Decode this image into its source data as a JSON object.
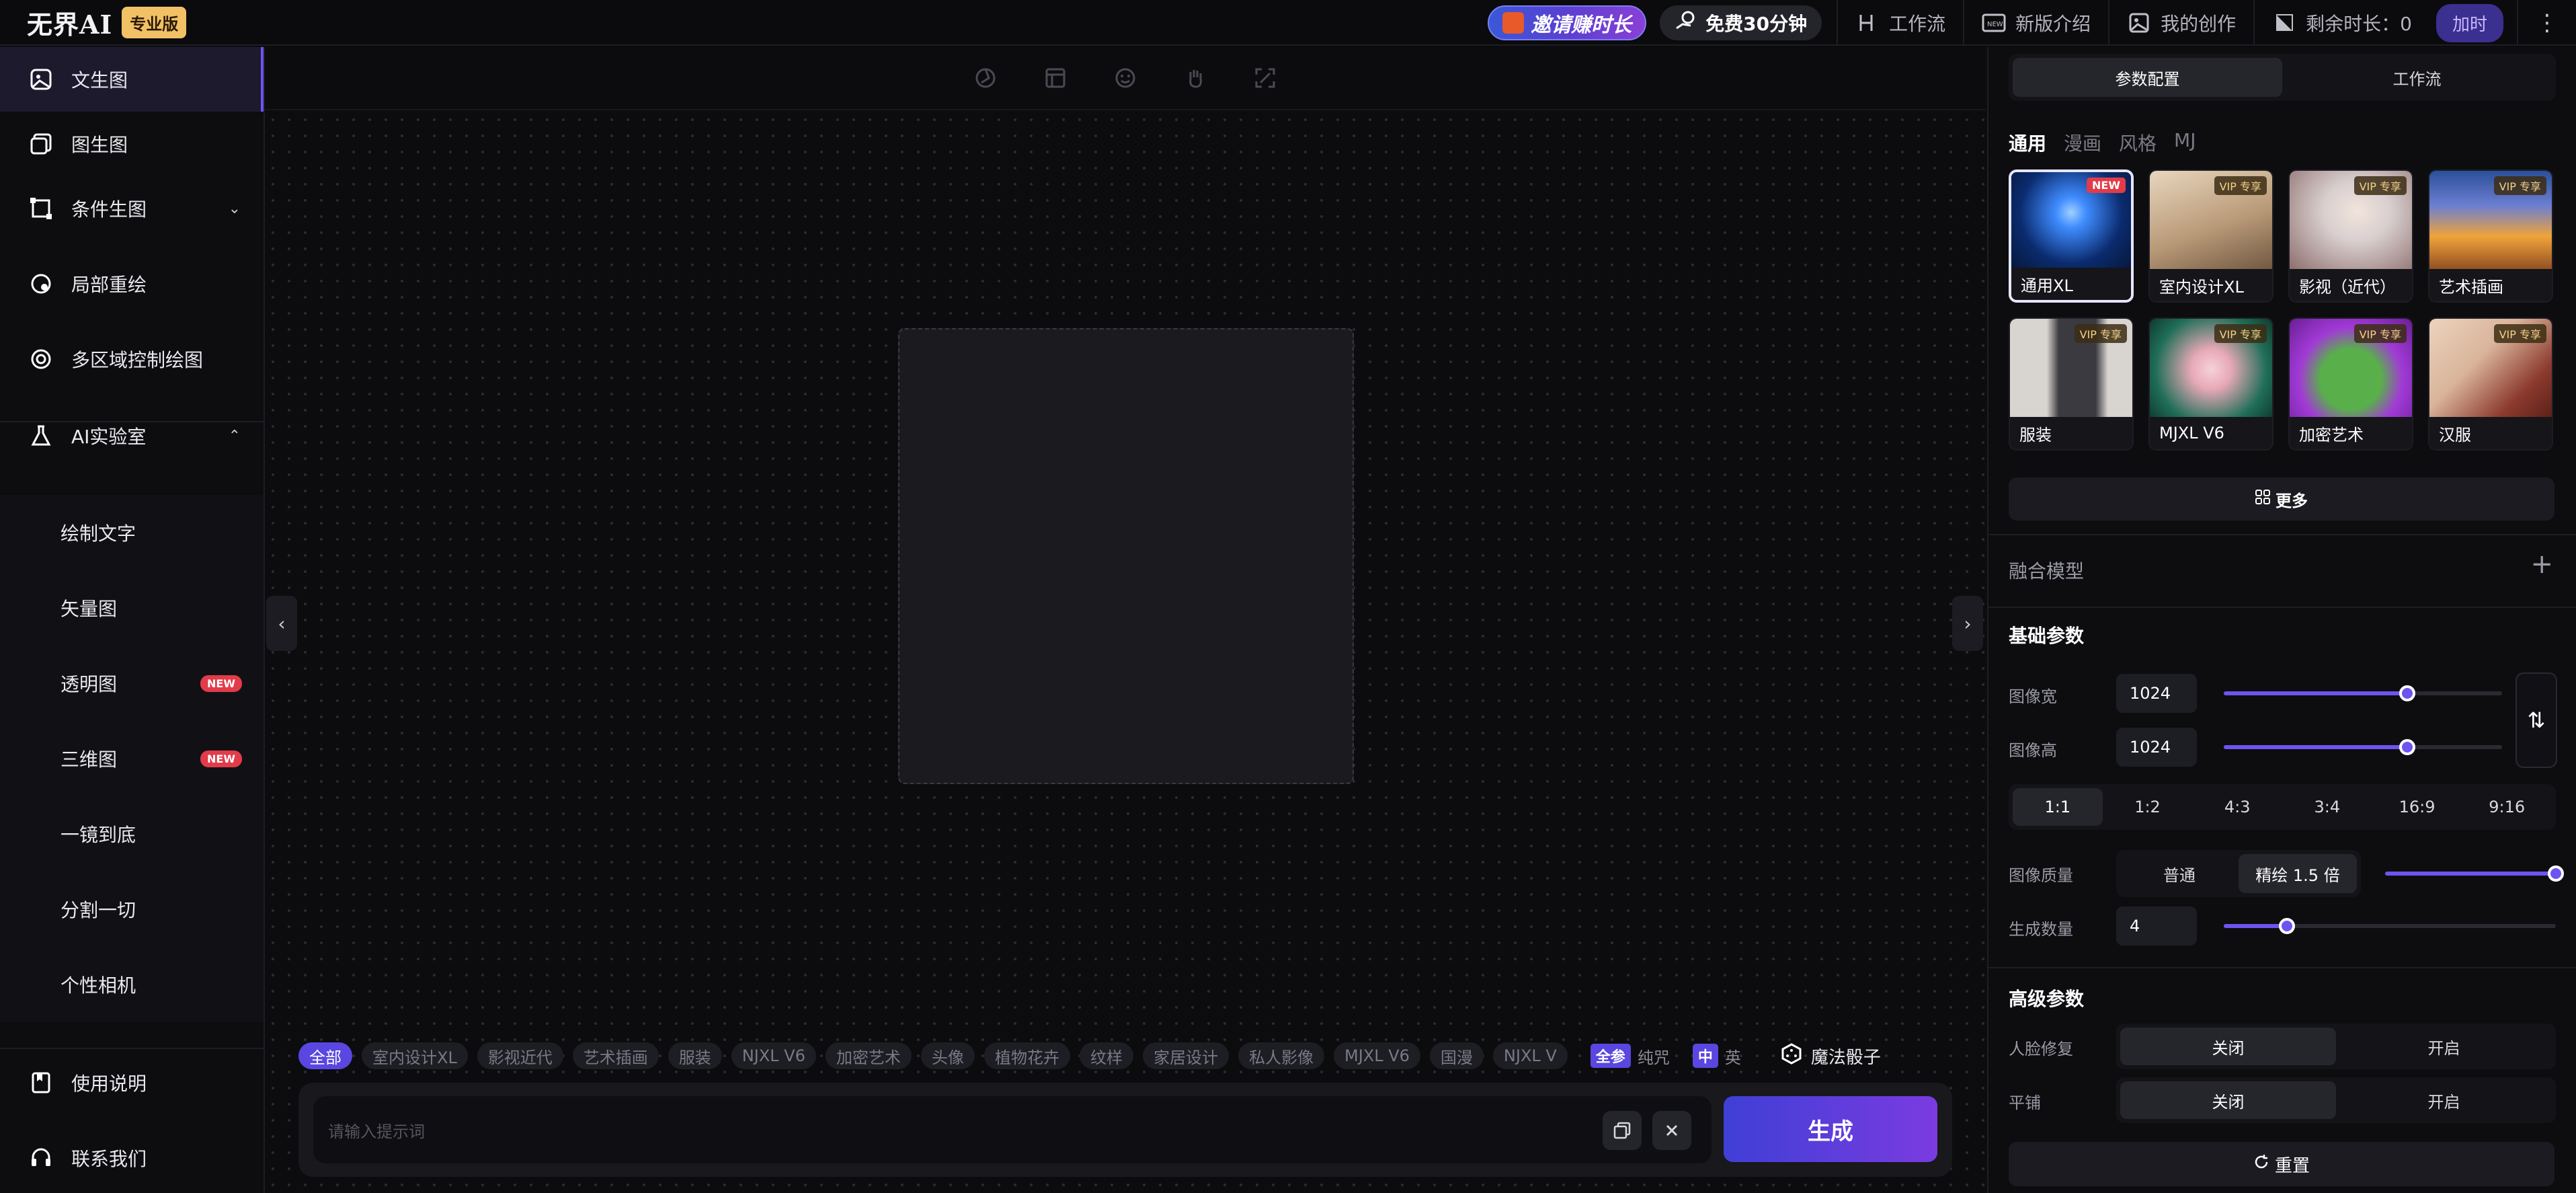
{
  "header": {
    "logo_text": "无界AI",
    "edition_badge": "专业版",
    "invite_label": "邀请赚时长",
    "free_label": "免费30分钟",
    "links": [
      {
        "label": "工作流",
        "icon": "workflow-icon"
      },
      {
        "label": "新版介绍",
        "icon": "new-icon"
      },
      {
        "label": "我的创作",
        "icon": "gallery-icon"
      },
      {
        "label": "剩余时长：0",
        "icon": "time-icon"
      }
    ],
    "recharge_label": "加时",
    "more_glyph": "⋮"
  },
  "sidebar": {
    "items": [
      {
        "label": "文生图",
        "icon": "image-icon"
      },
      {
        "label": "图生图",
        "icon": "images-icon"
      },
      {
        "label": "条件生图",
        "icon": "condition-icon",
        "caret": "⌄"
      },
      {
        "label": "局部重绘",
        "icon": "inpaint-icon"
      },
      {
        "label": "多区域控制绘图",
        "icon": "region-icon"
      },
      {
        "label": "AI实验室",
        "icon": "flask-icon",
        "caret": "⌃"
      }
    ],
    "lab_items": [
      {
        "label": "绘制文字",
        "badge": ""
      },
      {
        "label": "矢量图",
        "badge": ""
      },
      {
        "label": "透明图",
        "badge": "NEW"
      },
      {
        "label": "三维图",
        "badge": "NEW"
      },
      {
        "label": "一镜到底",
        "badge": ""
      },
      {
        "label": "分割一切",
        "badge": ""
      },
      {
        "label": "个性相机",
        "badge": ""
      }
    ],
    "footer": [
      {
        "label": "使用说明",
        "icon": "book-icon"
      },
      {
        "label": "联系我们",
        "icon": "headset-icon"
      }
    ]
  },
  "canvas": {
    "collapse_left": "‹",
    "collapse_right": "›"
  },
  "prompt": {
    "tags": [
      "全部",
      "室内设计XL",
      "影视近代",
      "艺术插画",
      "服装",
      "NJXL V6",
      "加密艺术",
      "头像",
      "植物花卉",
      "纹样",
      "家居设计",
      "私人影像",
      "MJXL V6",
      "国漫",
      "NJXL V"
    ],
    "mode_badge": "全参",
    "mode_label": "纯咒",
    "lang_badge": "中",
    "lang_label": "英",
    "dice_label": "魔法骰子",
    "placeholder": "请输入提示词",
    "generate_label": "生成"
  },
  "panel": {
    "top_tabs": [
      "参数配置",
      "工作流"
    ],
    "model_tabs": [
      "通用",
      "漫画",
      "风格",
      "MJ"
    ],
    "models": [
      {
        "label": "通用XL",
        "badge": "NEW",
        "colors": [
          "#0b2b6e",
          "#3f8cff"
        ]
      },
      {
        "label": "室内设计XL",
        "badge": "VIP 专享",
        "colors": [
          "#b99a78",
          "#e8d6bd"
        ]
      },
      {
        "label": "影视（近代）",
        "badge": "VIP 专享",
        "colors": [
          "#d9cfcf",
          "#8a6c6a"
        ]
      },
      {
        "label": "艺术插画",
        "badge": "VIP 专享",
        "colors": [
          "#2b4f9a",
          "#f0a33a"
        ]
      },
      {
        "label": "服装",
        "badge": "VIP 专享",
        "colors": [
          "#d8d4d0",
          "#3a3a40"
        ]
      },
      {
        "label": "MJXL V6",
        "badge": "VIP 专享",
        "colors": [
          "#1f6e57",
          "#e8a9b7"
        ]
      },
      {
        "label": "加密艺术",
        "badge": "VIP 专享",
        "colors": [
          "#a13ad6",
          "#59b04a"
        ]
      },
      {
        "label": "汉服",
        "badge": "VIP 专享",
        "colors": [
          "#d9b49a",
          "#8c3a2e"
        ]
      }
    ],
    "more_label": "更多",
    "merge_model_label": "融合模型",
    "basic_title": "基础参数",
    "width_label": "图像宽",
    "width_value": "1024",
    "width_fraction": 0.66,
    "height_label": "图像高",
    "height_value": "1024",
    "height_fraction": 0.66,
    "ratios": [
      "1:1",
      "1:2",
      "4:3",
      "3:4",
      "16:9",
      "9:16"
    ],
    "quality_label": "图像质量",
    "quality_options": [
      "普通",
      "精绘 1.5 倍"
    ],
    "quality_fraction": 1.0,
    "count_label": "生成数量",
    "count_value": "4",
    "count_fraction": 0.19,
    "advanced_title": "高级参数",
    "face_fix_label": "人脸修复",
    "tile_label": "平铺",
    "off_label": "关闭",
    "on_label": "开启",
    "reset_label": "重置",
    "accent": "#6d54f0"
  }
}
